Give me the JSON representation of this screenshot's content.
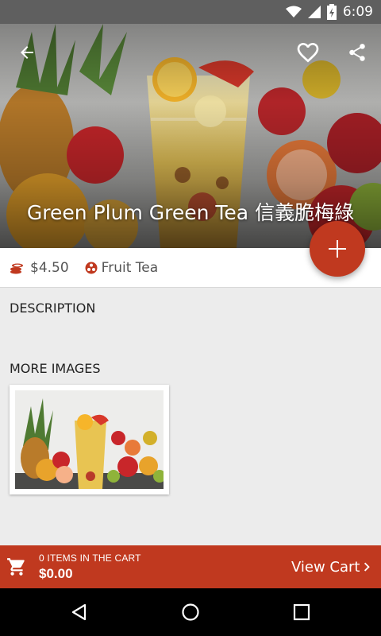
{
  "status_bar": {
    "time": "6:09"
  },
  "product": {
    "title": "Green Plum Green Tea 信義脆梅綠",
    "price": "$4.50",
    "category": "Fruit Tea"
  },
  "sections": {
    "description": "DESCRIPTION",
    "more_images": "MORE IMAGES"
  },
  "cart": {
    "count_text": "0 ITEMS IN THE CART",
    "total": "$0.00",
    "view_cart_label": "View Cart"
  },
  "icons": {
    "back": "arrow-back-icon",
    "favorite": "heart-outline-icon",
    "share": "share-icon",
    "add": "plus-icon",
    "price": "coins-icon",
    "category": "fruit-icon",
    "cart": "shopping-cart-icon",
    "view_cart": "chevron-right-icon"
  },
  "colors": {
    "accent": "#c0391f",
    "status_bar": "#5f5f5f",
    "background": "#ececec"
  }
}
